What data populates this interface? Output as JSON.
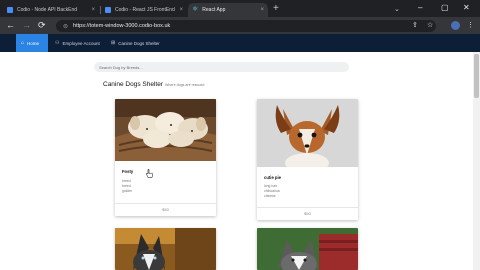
{
  "browser": {
    "tabs": [
      {
        "label": "Codio - Node API BackEnd",
        "active": false
      },
      {
        "label": "Codio - React JS FrontEnd",
        "active": false
      },
      {
        "label": "React App",
        "active": true
      }
    ],
    "url": "https://totem-window-3000.codio-box.uk",
    "new_tab": "+",
    "tab_close": "×",
    "tab_list": "⌄",
    "controls": {
      "minimize": "–",
      "maximize": "▢",
      "close": "✕"
    },
    "nav": {
      "back": "←",
      "forward": "→",
      "reload": "⟳"
    },
    "toolbar_icons": {
      "share": "⇪",
      "star": "☆",
      "menu": "⋮"
    },
    "lock": "⊜"
  },
  "appnav": {
    "items": [
      {
        "icon": "⌂",
        "label": "Home",
        "active": true
      },
      {
        "icon": "⚇",
        "label": "Employee Account",
        "active": false
      },
      {
        "icon": "⊞",
        "label": "Canine Dogs Shelter",
        "active": false
      }
    ]
  },
  "page": {
    "search_placeholder": "Search Dog by Breeds...",
    "heading": "Canine Dogs Shelter",
    "subheading": "Where dogs are rescued",
    "cards": [
      {
        "name": "Fosty",
        "lines": [
          "breed",
          "breed",
          "golden"
        ],
        "footer": "$50"
      },
      {
        "name": "cutie pie",
        "lines": [
          "long hair",
          "chihuahua",
          "chinese"
        ],
        "footer": "$50"
      },
      {
        "name": "",
        "lines": [],
        "footer": ""
      },
      {
        "name": "",
        "lines": [],
        "footer": ""
      }
    ]
  },
  "colors": {
    "tab_bar": "#202124",
    "toolbar": "#35363a",
    "app_nav": "#0c1f36",
    "nav_active": "#2b84e4"
  },
  "icons": {
    "favicon_codio": "codio-favicon-icon",
    "favicon_react": "react-atom-icon",
    "cursor": "hand-pointer-icon"
  }
}
